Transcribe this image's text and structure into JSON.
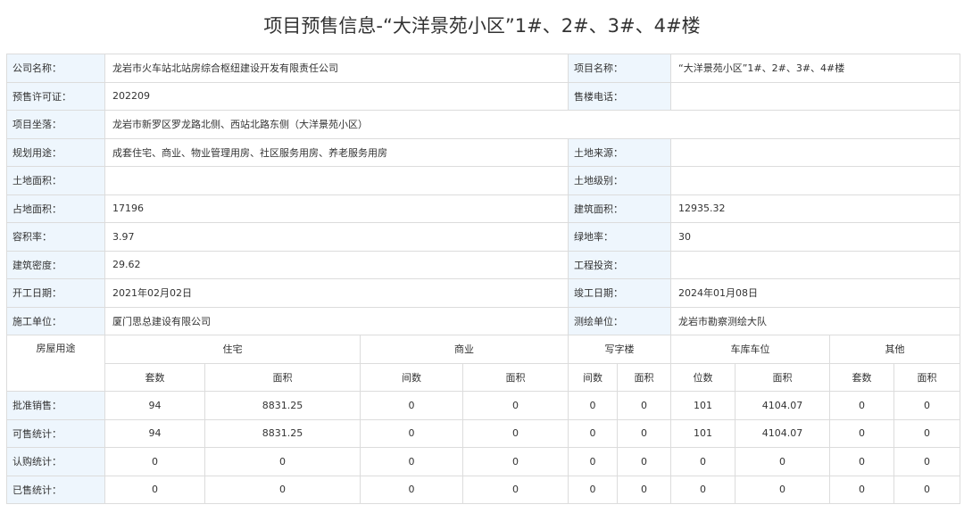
{
  "title": "项目预售信息-“大洋景苑小区”1#、2#、3#、4#楼",
  "info": {
    "company_label": "公司名称：",
    "company_value": "龙岩市火车站北站房综合枢纽建设开发有限责任公司",
    "project_label": "项目名称：",
    "project_value": "“大洋景苑小区”1#、2#、3#、4#楼",
    "permit_label": "预售许可证：",
    "permit_value": "202209",
    "phone_label": "售楼电话：",
    "phone_value": "",
    "location_label": "项目坐落：",
    "location_value": "龙岩市新罗区罗龙路北侧、西站北路东侧（大洋景苑小区）",
    "usage_label": "规划用途：",
    "usage_value": "成套住宅、商业、物业管理用房、社区服务用房、养老服务用房",
    "land_source_label": "土地来源：",
    "land_source_value": "",
    "land_area_label": "土地面积：",
    "land_area_value": "",
    "land_grade_label": "土地级别：",
    "land_grade_value": "",
    "site_area_label": "占地面积：",
    "site_area_value": "17196",
    "building_area_label": "建筑面积：",
    "building_area_value": "12935.32",
    "far_label": "容积率：",
    "far_value": "3.97",
    "green_label": "绿地率：",
    "green_value": "30",
    "density_label": "建筑密度：",
    "density_value": "29.62",
    "investment_label": "工程投资：",
    "investment_value": "",
    "start_label": "开工日期：",
    "start_value": "2021年02月02日",
    "finish_label": "竣工日期：",
    "finish_value": "2024年01月08日",
    "builder_label": "施工单位：",
    "builder_value": "厦门思总建设有限公司",
    "surveyor_label": "测绘单位：",
    "surveyor_value": "龙岩市勘察测绘大队"
  },
  "stats": {
    "usage_header": "房屋用途",
    "groups": [
      "住宅",
      "商业",
      "写字楼",
      "车库车位",
      "其他"
    ],
    "sub": [
      "套数",
      "面积",
      "间数",
      "面积",
      "间数",
      "面积",
      "位数",
      "面积",
      "套数",
      "面积"
    ],
    "rows": [
      {
        "label": "批准销售：",
        "values": [
          "94",
          "8831.25",
          "0",
          "0",
          "0",
          "0",
          "101",
          "4104.07",
          "0",
          "0"
        ]
      },
      {
        "label": "可售统计：",
        "values": [
          "94",
          "8831.25",
          "0",
          "0",
          "0",
          "0",
          "101",
          "4104.07",
          "0",
          "0"
        ]
      },
      {
        "label": "认购统计：",
        "values": [
          "0",
          "0",
          "0",
          "0",
          "0",
          "0",
          "0",
          "0",
          "0",
          "0"
        ]
      },
      {
        "label": "已售统计：",
        "values": [
          "0",
          "0",
          "0",
          "0",
          "0",
          "0",
          "0",
          "0",
          "0",
          "0"
        ]
      }
    ]
  }
}
